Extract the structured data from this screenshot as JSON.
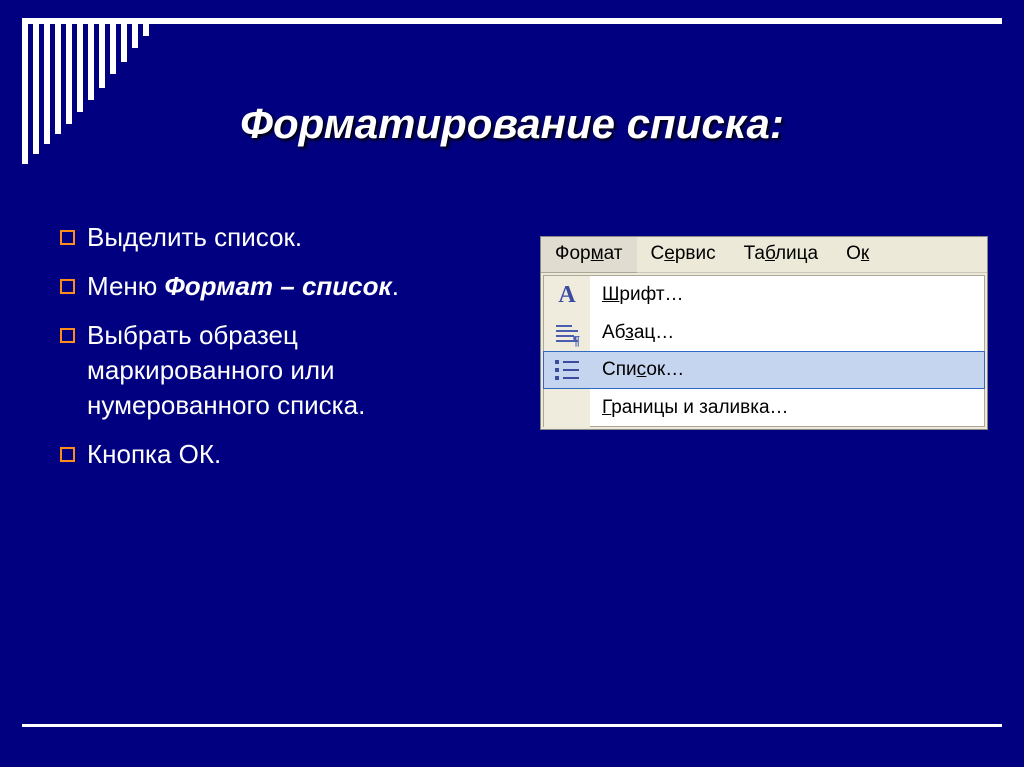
{
  "title": "Форматирование списка:",
  "bullets": {
    "item1": "Выделить список.",
    "item2_prefix": "Меню ",
    "item2_bold": "Формат – список",
    "item2_suffix": ".",
    "item3": "Выбрать образец маркированного или нумерованного списка.",
    "item4": "Кнопка ОК."
  },
  "menubar": {
    "format_pre": "Фор",
    "format_ul": "м",
    "format_post": "ат",
    "service": "С",
    "service_ul": "е",
    "service_post": "рвис",
    "table": "Та",
    "table_ul": "б",
    "table_post": "лица",
    "window": "О",
    "window_ul": "к",
    "window_post": ""
  },
  "dropdown": {
    "font_ul": "Ш",
    "font_post": "рифт…",
    "para_pre": "Аб",
    "para_ul": "з",
    "para_post": "ац…",
    "list_pre": "Спи",
    "list_ul": "с",
    "list_post": "ок…",
    "borders_ul": "Г",
    "borders_post": "раницы и заливка…"
  }
}
